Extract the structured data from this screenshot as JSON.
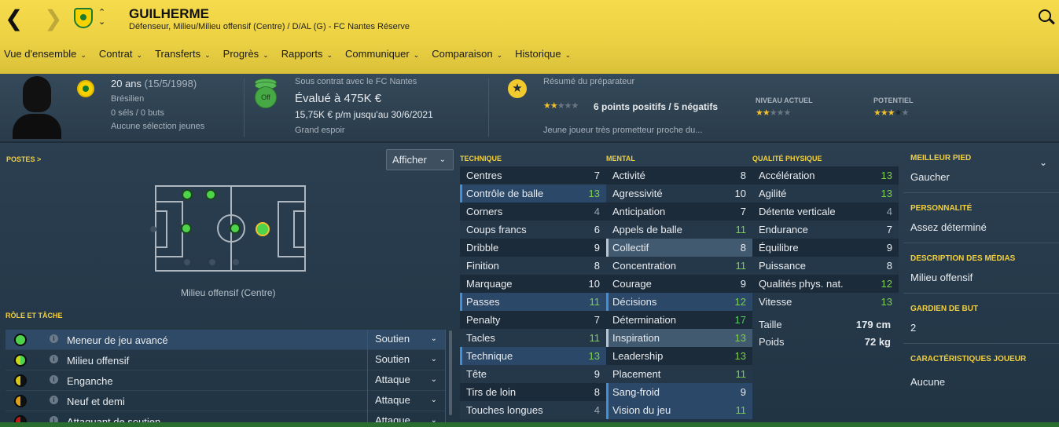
{
  "header": {
    "name": "GUILHERME",
    "subtitle": "Défenseur, Milieu/Milieu offensif (Centre) / D/AL (G) - FC Nantes Réserve"
  },
  "tabs": [
    "Vue d'ensemble",
    "Contrat",
    "Transferts",
    "Progrès",
    "Rapports",
    "Communiquer",
    "Comparaison",
    "Historique"
  ],
  "info": {
    "age": "20 ans",
    "dob": "(15/5/1998)",
    "nationality": "Brésilien",
    "caps": "0 séls / 0 buts",
    "youth": "Aucune sélection jeunes",
    "contract_icon": "Off",
    "contract_line": "Sous contrat avec le FC Nantes",
    "valued": "Évalué à 475K €",
    "wage": "15,75K € p/m jusqu'au 30/6/2021",
    "status": "Grand espoir",
    "scout_title": "Résumé du préparateur",
    "scout_points": "6 points positifs / 5 négatifs",
    "scout_desc": "Jeune joueur très prometteur proche du...",
    "current_label": "NIVEAU ACTUEL",
    "potential_label": "POTENTIEL",
    "scout_stars": 2,
    "current_stars": 2,
    "potential_stars": 3.5
  },
  "positions": {
    "title": "POSTES >",
    "show": "Afficher",
    "label": "Milieu offensif (Centre)"
  },
  "roles": {
    "title": "RÔLE ET TÂCHE",
    "items": [
      {
        "name": "Meneur de jeu avancé",
        "duty": "Soutien",
        "l": "#4fd34a",
        "r": "#4fd34a"
      },
      {
        "name": "Milieu offensif",
        "duty": "Soutien",
        "l": "#c8d81e",
        "r": "#4fd34a"
      },
      {
        "name": "Enganche",
        "duty": "Attaque",
        "l": "#d8c81a",
        "r": "#111111"
      },
      {
        "name": "Neuf et demi",
        "duty": "Attaque",
        "l": "#e0a01a",
        "r": "#111111"
      },
      {
        "name": "Attaquant de soutien",
        "duty": "Attaque",
        "l": "#c01a1a",
        "r": "#111111"
      }
    ]
  },
  "technique": {
    "title": "TECHNIQUE",
    "rows": [
      [
        "Centres",
        "7",
        ""
      ],
      [
        "Contrôle de balle",
        "13",
        "hl"
      ],
      [
        "Corners",
        "4",
        ""
      ],
      [
        "Coups francs",
        "6",
        ""
      ],
      [
        "Dribble",
        "9",
        ""
      ],
      [
        "Finition",
        "8",
        ""
      ],
      [
        "Marquage",
        "10",
        ""
      ],
      [
        "Passes",
        "11",
        "hl"
      ],
      [
        "Penalty",
        "7",
        ""
      ],
      [
        "Tacles",
        "11",
        ""
      ],
      [
        "Technique",
        "13",
        "hl"
      ],
      [
        "Tête",
        "9",
        ""
      ],
      [
        "Tirs de loin",
        "8",
        ""
      ],
      [
        "Touches longues",
        "4",
        ""
      ]
    ]
  },
  "mental": {
    "title": "MENTAL",
    "rows": [
      [
        "Activité",
        "8",
        ""
      ],
      [
        "Agressivité",
        "10",
        ""
      ],
      [
        "Anticipation",
        "7",
        ""
      ],
      [
        "Appels de balle",
        "11",
        ""
      ],
      [
        "Collectif",
        "8",
        "hl2"
      ],
      [
        "Concentration",
        "11",
        ""
      ],
      [
        "Courage",
        "9",
        ""
      ],
      [
        "Décisions",
        "12",
        "hl"
      ],
      [
        "Détermination",
        "17",
        ""
      ],
      [
        "Inspiration",
        "13",
        "hl2"
      ],
      [
        "Leadership",
        "13",
        ""
      ],
      [
        "Placement",
        "11",
        ""
      ],
      [
        "Sang-froid",
        "9",
        "hl"
      ],
      [
        "Vision du jeu",
        "11",
        "hl"
      ]
    ]
  },
  "physical": {
    "title": "QUALITÉ PHYSIQUE",
    "rows": [
      [
        "Accélération",
        "13",
        ""
      ],
      [
        "Agilité",
        "13",
        ""
      ],
      [
        "Détente verticale",
        "4",
        ""
      ],
      [
        "Endurance",
        "7",
        ""
      ],
      [
        "Équilibre",
        "9",
        ""
      ],
      [
        "Puissance",
        "8",
        ""
      ],
      [
        "Qualités phys. nat.",
        "12",
        ""
      ],
      [
        "Vitesse",
        "13",
        ""
      ]
    ],
    "height_label": "Taille",
    "height": "179 cm",
    "weight_label": "Poids",
    "weight": "72 kg"
  },
  "right": [
    {
      "h": "MEILLEUR PIED",
      "v": "Gaucher"
    },
    {
      "h": "PERSONNALITÉ",
      "v": "Assez déterminé"
    },
    {
      "h": "DESCRIPTION DES MÉDIAS",
      "v": "Milieu offensif"
    },
    {
      "h": "GARDIEN DE BUT",
      "v": "2"
    },
    {
      "h": "CARACTÉRISTIQUES JOUEUR",
      "v": "Aucune"
    }
  ]
}
